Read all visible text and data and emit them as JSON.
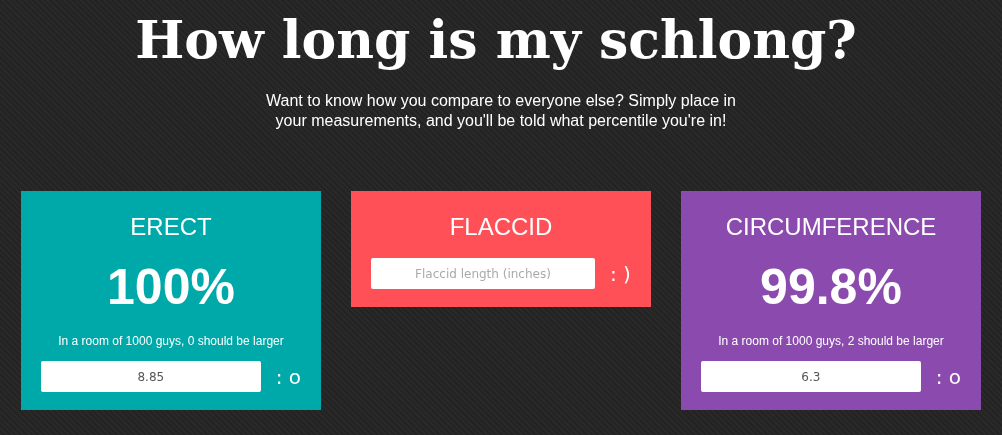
{
  "title": "How long is my schlong?",
  "intro": "Want to know how you compare to everyone else? Simply place in your measurements, and you'll be told what percentile you're in!",
  "cards": [
    {
      "title": "ERECT",
      "color": "#00a9a9",
      "result": "100%",
      "note": "In a room of 1000 guys, 0 should be larger",
      "input": {
        "value": "8.85"
      },
      "face": ": o"
    },
    {
      "title": "FLACCID",
      "color": "#ff5057",
      "input": {
        "placeholder": "Flaccid length (inches)"
      },
      "face": ": )"
    },
    {
      "title": "CIRCUMFERENCE",
      "color": "#8b4bae",
      "result": "99.8%",
      "note": "In a room of 1000 guys, 2 should be larger",
      "input": {
        "value": "6.3"
      },
      "face": ": o"
    }
  ]
}
